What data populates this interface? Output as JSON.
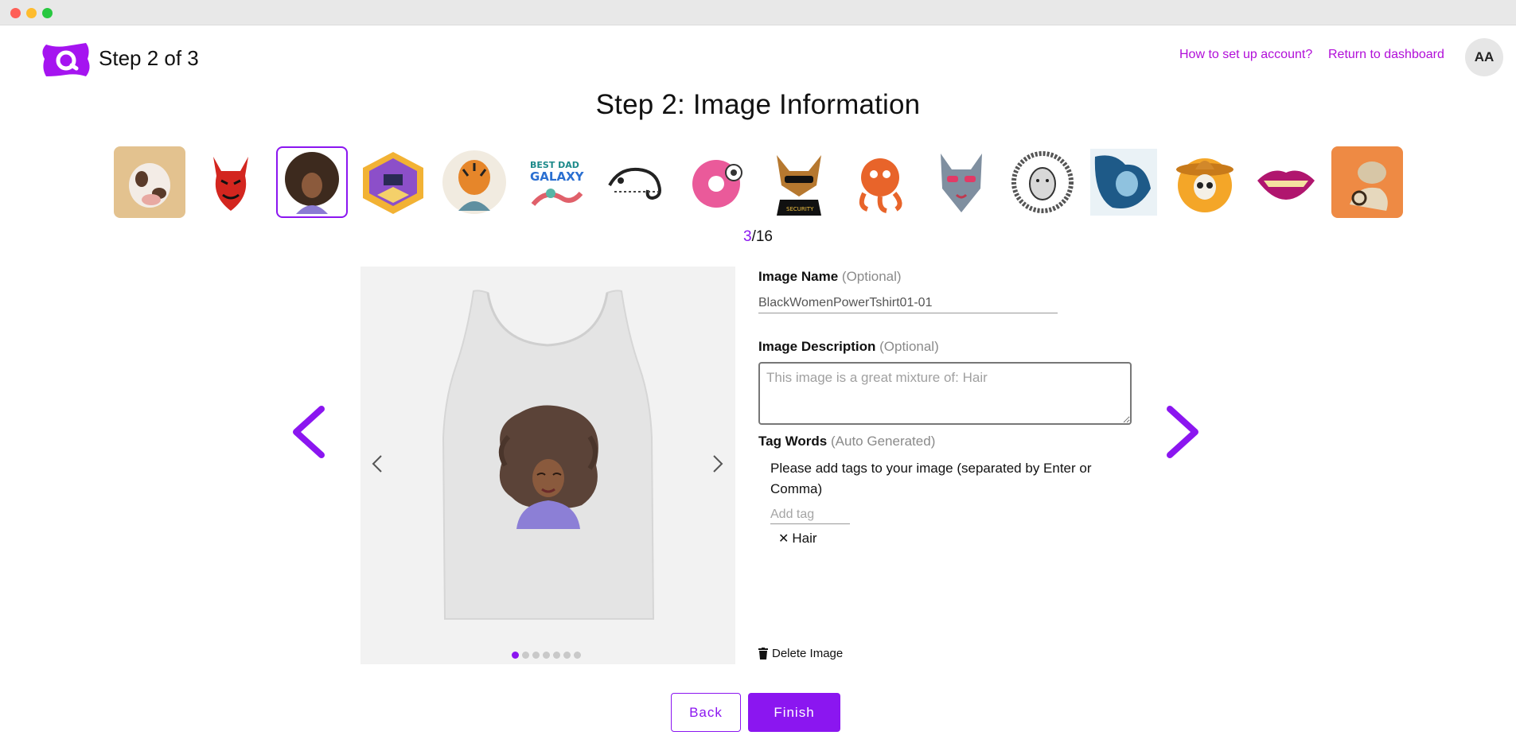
{
  "window": {
    "controls": [
      "close",
      "minimize",
      "maximize"
    ]
  },
  "header": {
    "logo_icon": "brand-logo-icon",
    "step_label": "Step 2 of 3",
    "links": {
      "how_to": "How to set up account?",
      "dashboard": "Return to dashboard"
    },
    "avatar_initials": "AA"
  },
  "main": {
    "title": "Step 2: Image Information",
    "thumbnails": [
      "cow-art",
      "devil-art",
      "afro-woman-art",
      "isometric-room-art",
      "tiger-art",
      "best-dad-galaxy-art",
      "chameleon-art",
      "donut-art",
      "security-dog-art",
      "octopus-art",
      "wolf-art",
      "lion-sketch-art",
      "blue-lion-art",
      "sombrero-skull-art",
      "lips-art",
      "retro-cat-art"
    ],
    "selected_index": 3,
    "counter": {
      "current": "3",
      "total": "/16"
    },
    "preview_pages": 7,
    "preview_active_page": 1
  },
  "form": {
    "name": {
      "label": "Image Name",
      "hint": "(Optional)",
      "value": "BlackWomenPowerTshirt01-01"
    },
    "description": {
      "label": "Image Description",
      "hint": "(Optional)",
      "placeholder": "This image is a great mixture of: Hair"
    },
    "tags": {
      "label": "Tag Words",
      "hint": "(Auto Generated)",
      "help": "Please add tags to your image (separated by Enter or Comma)",
      "placeholder": "Add tag",
      "items": [
        "Hair"
      ]
    },
    "delete_label": "Delete Image"
  },
  "actions": {
    "back": "Back",
    "finish": "Finish"
  },
  "colors": {
    "accent": "#8b16f0",
    "link": "#b10ed8"
  }
}
